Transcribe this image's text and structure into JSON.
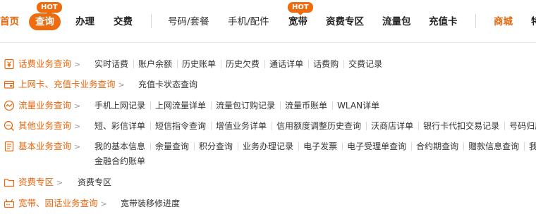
{
  "nav": {
    "hot_badge": "HOT",
    "items": {
      "home": "首页",
      "query": "查询",
      "handle": "办理",
      "pay": "交费",
      "number": "号码/套餐",
      "phone": "手机/配件",
      "broadband": "宽带",
      "zone": "资费专区",
      "flow": "流量包",
      "recharge": "充值卡",
      "mall": "商城",
      "special": "特"
    }
  },
  "categories": [
    {
      "title": "话费业务查询",
      "icon": "yuan-doc-icon",
      "links": [
        "实时话费",
        "账户余额",
        "历史账单",
        "历史欠费",
        "通话详单",
        "话费购",
        "交费记录"
      ]
    },
    {
      "title": "上网卡、充值卡业务查询",
      "icon": "card-icon",
      "links": [
        "充值卡状态查询"
      ]
    },
    {
      "title": "流量业务查询",
      "icon": "flow-wave-icon",
      "links": [
        "手机上网记录",
        "上网流量详单",
        "流量包订购记录",
        "流量币账单",
        "WLAN详单"
      ]
    },
    {
      "title": "其他业务查询",
      "icon": "search-icon",
      "links": [
        "短、彩信详单",
        "短信指令查询",
        "增值业务详单",
        "信用额度调整历史查询",
        "沃商店详单",
        "银行卡代扣交易记录",
        "号码归属地"
      ]
    },
    {
      "title": "基本业务查询",
      "icon": "document-icon",
      "links": [
        "我的基本信息",
        "余量查询",
        "积分查询",
        "业务办理记录",
        "电子发票",
        "电子受理单查询",
        "合约期查询",
        "赠款信息查询",
        "我已"
      ],
      "links2": [
        "金融合约账单"
      ]
    },
    {
      "title": "资费专区",
      "icon": "folder-icon",
      "links": [
        "资费专区"
      ]
    },
    {
      "title": "宽带、固话业务查询",
      "icon": "broadband-icon",
      "links": [
        "宽带装移修进度"
      ]
    }
  ]
}
